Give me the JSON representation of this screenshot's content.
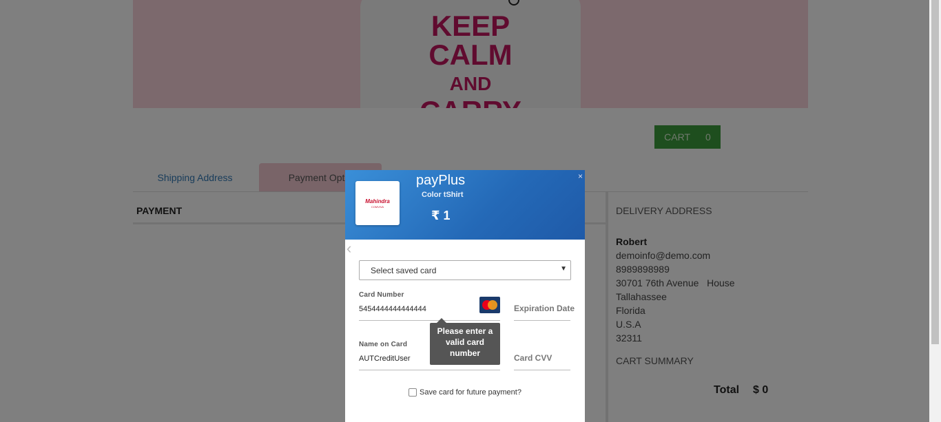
{
  "hero": {
    "line1": "KEEP",
    "line2": "CALM",
    "line3": "AND",
    "line4": "CARRY"
  },
  "cart": {
    "label": "CART",
    "count": "0"
  },
  "tabs": [
    {
      "label": "Shipping Address"
    },
    {
      "label": "Payment Optio"
    }
  ],
  "payment": {
    "heading": "PAYMENT"
  },
  "delivery": {
    "heading": "DELIVERY ADDRESS",
    "name": "Robert",
    "email": "demoinfo@demo.com",
    "phone": "8989898989",
    "street": "30701 76th Avenue   House",
    "city": "Tallahassee",
    "state": "Florida",
    "country": "U.S.A",
    "zip": "32311"
  },
  "cart_summary": {
    "heading": "CART SUMMARY",
    "total_label": "Total",
    "total_value": "$ 0"
  },
  "modal": {
    "app_name": "payPlus",
    "product": "Color tShirt",
    "amount": "₹ 1",
    "merchant_logo_text": "Mahindra",
    "merchant_logo_sub": "COMVIVA",
    "close": "×",
    "back": "‹",
    "saved_card": "Select saved card",
    "card_number_label": "Card Number",
    "card_number_value": "5454444444444444",
    "expiry_placeholder": "Expiration Date",
    "name_label": "Name on Card",
    "name_value": "AUTCreditUser",
    "cvv_placeholder": "Card CVV",
    "tooltip": "Please enter a valid card number",
    "save_card_label": "Save card for future payment?",
    "card_brand": "mastercard-icon"
  },
  "colors": {
    "cart_button": "#3c9d3c",
    "modal_header": "#2469b7",
    "hero_bg": "#f8d3da",
    "shirt_text": "#c1175e"
  }
}
